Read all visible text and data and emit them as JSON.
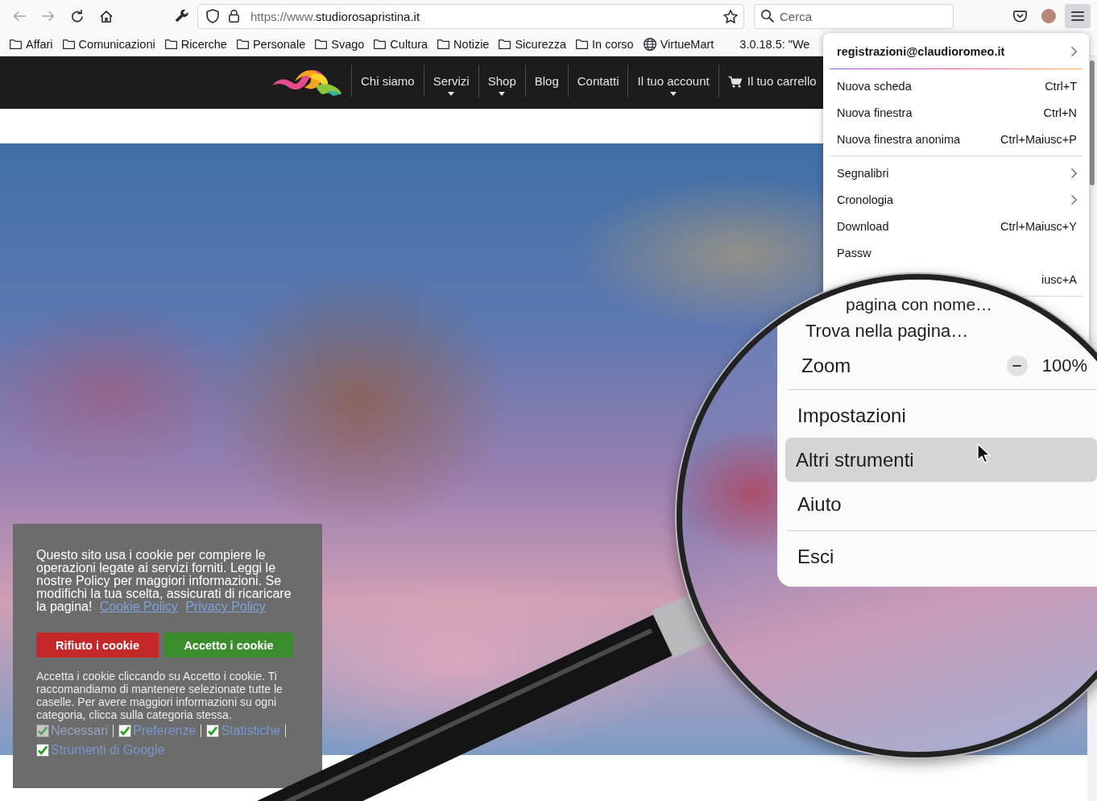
{
  "toolbar": {
    "nav_buttons": [
      {
        "kind": "back",
        "disabled": true
      },
      {
        "kind": "forward",
        "disabled": true
      },
      {
        "kind": "reload",
        "disabled": false
      },
      {
        "kind": "home",
        "disabled": false
      }
    ],
    "url": {
      "scheme": "https://www.",
      "domain": "studiorosapristina.it"
    },
    "search": {
      "placeholder": "Cerca"
    },
    "menu_button": {
      "pressed": true
    }
  },
  "bookmarks": [
    {
      "kind": "folder",
      "label": "Affari"
    },
    {
      "kind": "folder",
      "label": "Comunicazioni"
    },
    {
      "kind": "folder",
      "label": "Ricerche"
    },
    {
      "kind": "folder",
      "label": "Personale"
    },
    {
      "kind": "folder",
      "label": "Svago"
    },
    {
      "kind": "folder",
      "label": "Cultura"
    },
    {
      "kind": "folder",
      "label": "Notizie"
    },
    {
      "kind": "folder",
      "label": "Sicurezza"
    },
    {
      "kind": "folder",
      "label": "In corso"
    },
    {
      "kind": "site",
      "label": "VirtueMart"
    },
    {
      "kind": "plain",
      "label": "3.0.18.5: \"We"
    }
  ],
  "site_nav": {
    "items": [
      {
        "kind": "link",
        "label": "Chi siamo",
        "dropdown": false
      },
      {
        "kind": "link",
        "label": "Servizi",
        "dropdown": true
      },
      {
        "kind": "link",
        "label": "Shop",
        "dropdown": true
      },
      {
        "kind": "link",
        "label": "Blog",
        "dropdown": false
      },
      {
        "kind": "link",
        "label": "Contatti",
        "dropdown": false
      },
      {
        "kind": "link",
        "label": "Il tuo account",
        "dropdown": true
      },
      {
        "kind": "cart",
        "label": "Il tuo carrello",
        "dropdown": false
      }
    ]
  },
  "app_menu": {
    "items": [
      {
        "kind": "account",
        "label": "registrazioni@claudioromeo.it"
      },
      {
        "kind": "item",
        "label": "Nuova scheda",
        "shortcut": "Ctrl+T"
      },
      {
        "kind": "item",
        "label": "Nuova finestra",
        "shortcut": "Ctrl+N"
      },
      {
        "kind": "item",
        "label": "Nuova finestra anonima",
        "shortcut": "Ctrl+Maiusc+P"
      },
      {
        "kind": "separator"
      },
      {
        "kind": "submenu",
        "label": "Segnalibri"
      },
      {
        "kind": "submenu",
        "label": "Cronologia"
      },
      {
        "kind": "item",
        "label": "Download",
        "shortcut": "Ctrl+Maiusc+Y"
      },
      {
        "kind": "item",
        "label": "Passw"
      },
      {
        "kind": "item",
        "shortcut": "iusc+A"
      },
      {
        "kind": "separator"
      }
    ]
  },
  "magnifier": {
    "items": [
      {
        "kind": "item",
        "label": "pagina con nome…",
        "hovered": false
      },
      {
        "kind": "item",
        "label": "Trova nella pagina…",
        "hovered": false
      },
      {
        "kind": "zoom",
        "label": "Zoom",
        "value": "100%"
      },
      {
        "kind": "separator"
      },
      {
        "kind": "item",
        "label": "Impostazioni",
        "hovered": false
      },
      {
        "kind": "item",
        "label": "Altri strumenti",
        "hovered": true
      },
      {
        "kind": "item",
        "label": "Aiuto",
        "hovered": false
      },
      {
        "kind": "separator"
      },
      {
        "kind": "item",
        "label": "Esci",
        "hovered": false
      }
    ]
  },
  "cookie_banner": {
    "message": "Questo sito usa i cookie per compiere le operazioni legate ai servizi forniti. Leggi le nostre Policy per maggiori informazioni. Se modifichi la tua scelta, assicurati di ricaricare la pagina!",
    "links": [
      "Cookie Policy",
      "Privacy Policy"
    ],
    "buttons": [
      {
        "kind": "reject",
        "label": "Rifiuto i cookie"
      },
      {
        "kind": "accept",
        "label": "Accetto i cookie"
      }
    ],
    "note": "Accetta i cookie cliccando su Accetto i cookie. Ti raccomandiamo di mantenere selezionate tutte le caselle. Per avere maggiori informazioni su ogni categoria, clicca sulla categoria stessa.",
    "categories": [
      {
        "label": "Necessari",
        "checked": true,
        "disabled": true
      },
      {
        "label": "Preferenze",
        "checked": true,
        "disabled": false
      },
      {
        "label": "Statistiche",
        "checked": true,
        "disabled": false
      },
      {
        "label": "Strumenti di Google",
        "checked": true,
        "disabled": false
      }
    ]
  }
}
